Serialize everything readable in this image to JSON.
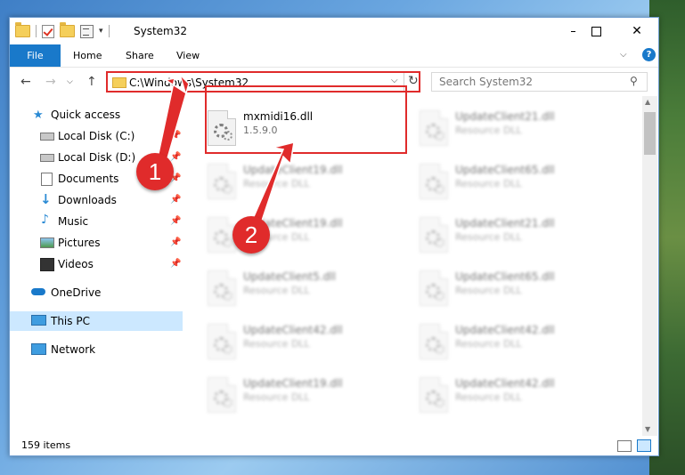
{
  "window": {
    "title": "System32",
    "minimize": "—",
    "close": "✕"
  },
  "ribbon": {
    "tabs": [
      "File",
      "Home",
      "Share",
      "View"
    ],
    "help": "?"
  },
  "address": {
    "path": "C:\\Windows\\System32",
    "search_placeholder": "Search System32"
  },
  "nav": {
    "items": [
      {
        "label": "Quick access",
        "icon": "star-icon"
      },
      {
        "label": "Local Disk (C:)",
        "icon": "drive-icon"
      },
      {
        "label": "Local Disk (D:)",
        "icon": "drive-icon"
      },
      {
        "label": "Documents",
        "icon": "documents-icon"
      },
      {
        "label": "Downloads",
        "icon": "download-icon"
      },
      {
        "label": "Music",
        "icon": "music-icon"
      },
      {
        "label": "Pictures",
        "icon": "pictures-icon"
      },
      {
        "label": "Videos",
        "icon": "videos-icon"
      },
      {
        "label": "OneDrive",
        "icon": "cloud-icon"
      },
      {
        "label": "This PC",
        "icon": "computer-icon"
      },
      {
        "label": "Network",
        "icon": "network-icon"
      }
    ]
  },
  "files": [
    {
      "name": "mxmidi16.dll",
      "sub": "1.5.9.0"
    },
    {
      "name": "UpdateClient21.dll",
      "sub": "Resource DLL"
    },
    {
      "name": "UpdateClient19.dll",
      "sub": "Resource DLL"
    },
    {
      "name": "UpdateClient65.dll",
      "sub": "Resource DLL"
    },
    {
      "name": "UpdateClient19.dll",
      "sub": "Resource DLL"
    },
    {
      "name": "UpdateClient21.dll",
      "sub": "Resource DLL"
    },
    {
      "name": "UpdateClient5.dll",
      "sub": "Resource DLL"
    },
    {
      "name": "UpdateClient65.dll",
      "sub": "Resource DLL"
    },
    {
      "name": "UpdateClient42.dll",
      "sub": "Resource DLL"
    },
    {
      "name": "UpdateClient42.dll",
      "sub": "Resource DLL"
    },
    {
      "name": "UpdateClient19.dll",
      "sub": "Resource DLL"
    },
    {
      "name": "UpdateClient42.dll",
      "sub": "Resource DLL"
    }
  ],
  "status": {
    "count": "159 items"
  },
  "annotations": {
    "badge1": "1",
    "badge2": "2",
    "color": "#e02b2b"
  }
}
